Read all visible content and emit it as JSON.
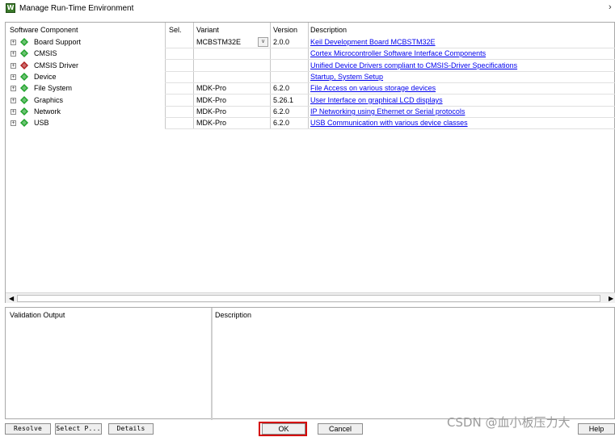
{
  "window": {
    "title": "Manage Run-Time Environment",
    "close_glyph": "›"
  },
  "grid": {
    "headers": {
      "component": "Software Component",
      "sel": "Sel.",
      "variant": "Variant",
      "version": "Version",
      "description": "Description"
    },
    "rows": [
      {
        "name": "Board Support",
        "icon": "green-gem-icon",
        "variant": "MCBSTM32E",
        "version": "2.0.0",
        "description": "Keil Development Board MCBSTM32E"
      },
      {
        "name": "CMSIS",
        "icon": "green-gem-icon",
        "variant": "",
        "version": "",
        "description": "Cortex Microcontroller Software Interface Components"
      },
      {
        "name": "CMSIS Driver",
        "icon": "red-gem-icon",
        "variant": "",
        "version": "",
        "description": "Unified Device Drivers compliant to CMSIS-Driver Specifications"
      },
      {
        "name": "Device",
        "icon": "green-gem-icon",
        "variant": "",
        "version": "",
        "description": "Startup, System Setup"
      },
      {
        "name": "File System",
        "icon": "green-gem-icon",
        "variant": "MDK-Pro",
        "version": "6.2.0",
        "description": "File Access on various storage devices"
      },
      {
        "name": "Graphics",
        "icon": "green-gem-icon",
        "variant": "MDK-Pro",
        "version": "5.26.1",
        "description": "User Interface on graphical LCD displays"
      },
      {
        "name": "Network",
        "icon": "green-gem-icon",
        "variant": "MDK-Pro",
        "version": "6.2.0",
        "description": "IP Networking using Ethernet or Serial protocols"
      },
      {
        "name": "USB",
        "icon": "green-gem-icon",
        "variant": "MDK-Pro",
        "version": "6.2.0",
        "description": "USB Communication with various device classes"
      }
    ]
  },
  "validation": {
    "output_label": "Validation Output",
    "description_label": "Description"
  },
  "buttons": {
    "resolve": "Resolve",
    "select_packs": "Select P...",
    "details": "Details",
    "ok": "OK",
    "cancel": "Cancel",
    "help": "Help"
  },
  "colors": {
    "green_gem": "#1fa32a",
    "red_gem": "#b02020",
    "link": "#0000ee",
    "highlight_frame": "#d40000"
  },
  "watermark": "CSDN @血小板压力大"
}
